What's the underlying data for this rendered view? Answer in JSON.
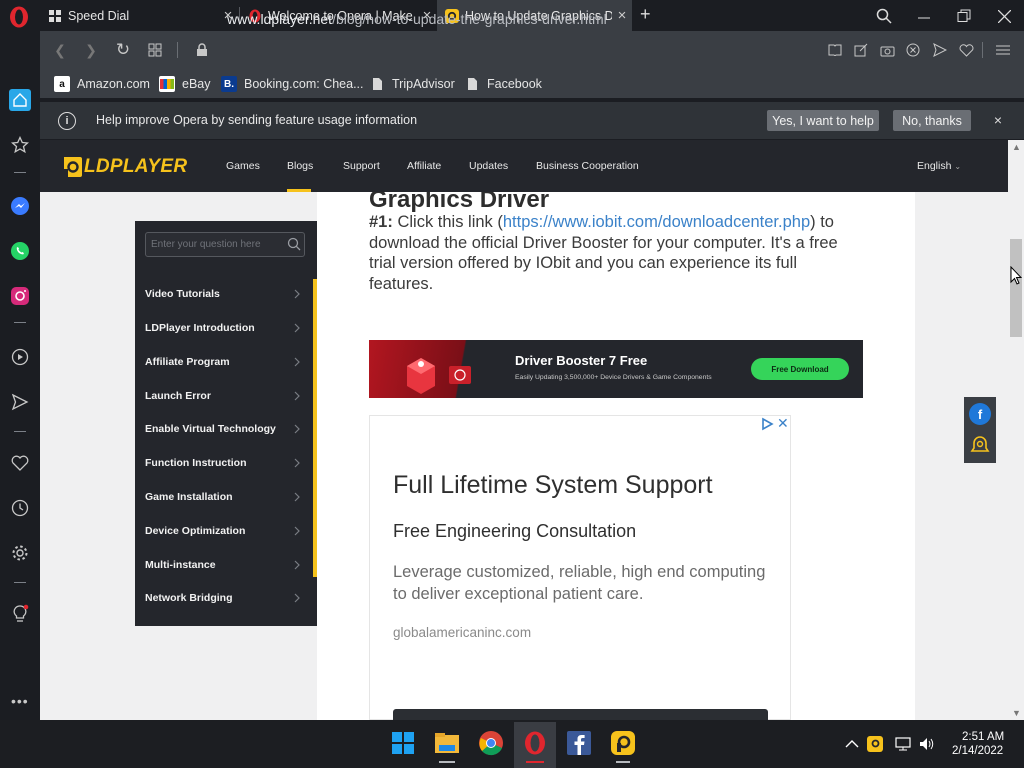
{
  "tabs": [
    {
      "title": "Speed Dial",
      "icon": "speed-dial-icon"
    },
    {
      "title": "Welcome to Opera | Make",
      "icon": "opera-icon"
    },
    {
      "title": "How to Update Graphics D",
      "icon": "ldplayer-icon"
    }
  ],
  "address": {
    "domain": "www.ldplayer.net",
    "path": "/blog/how-to-update-the-graphics-driver.html"
  },
  "bookmarks": [
    {
      "label": "Amazon.com",
      "icon": "amazon-icon"
    },
    {
      "label": "eBay",
      "icon": "ebay-icon"
    },
    {
      "label": "Booking.com: Chea...",
      "icon": "booking-icon"
    },
    {
      "label": "TripAdvisor",
      "icon": "page-icon"
    },
    {
      "label": "Facebook",
      "icon": "page-icon"
    }
  ],
  "infobar": {
    "text": "Help improve Opera by sending feature usage information",
    "yes": "Yes, I want to help",
    "no": "No, thanks",
    "close": "×"
  },
  "site": {
    "logo": "LDPLAYER",
    "nav": [
      "Games",
      "Blogs",
      "Support",
      "Affiliate",
      "Updates",
      "Business Cooperation"
    ],
    "language": "English",
    "search_placeholder": "Enter your question here",
    "menu": [
      "Video Tutorials",
      "LDPlayer Introduction",
      "Affiliate Program",
      "Launch Error",
      "Enable Virtual Technology",
      "Function Instruction",
      "Game Installation",
      "Device Optimization",
      "Multi-instance",
      "Network Bridging"
    ]
  },
  "article": {
    "heading": "Graphics Driver",
    "step_label": "#1:",
    "step_text1": " Click this link (",
    "link": "https://www.iobit.com/downloadcenter.php",
    "step_text2": ") to download the official Driver Booster for your computer. It's a free trial version offered by IObit and you can experience its full features."
  },
  "banner": {
    "title": "Driver Booster 7 Free",
    "subtitle": "Easily Updating 3,500,000+ Device Drivers & Game Components",
    "button": "Free Download"
  },
  "ad": {
    "headline": "Full Lifetime System Support",
    "subheadline": "Free Engineering Consultation",
    "body": "Leverage customized, reliable, high end computing to deliver exceptional patient care.",
    "url": "globalamericaninc.com"
  },
  "clock": {
    "time": "2:51 AM",
    "date": "2/14/2022"
  },
  "colors": {
    "accent": "#f6c21c",
    "link": "#3b82c9",
    "opera_red": "#e0262e"
  }
}
